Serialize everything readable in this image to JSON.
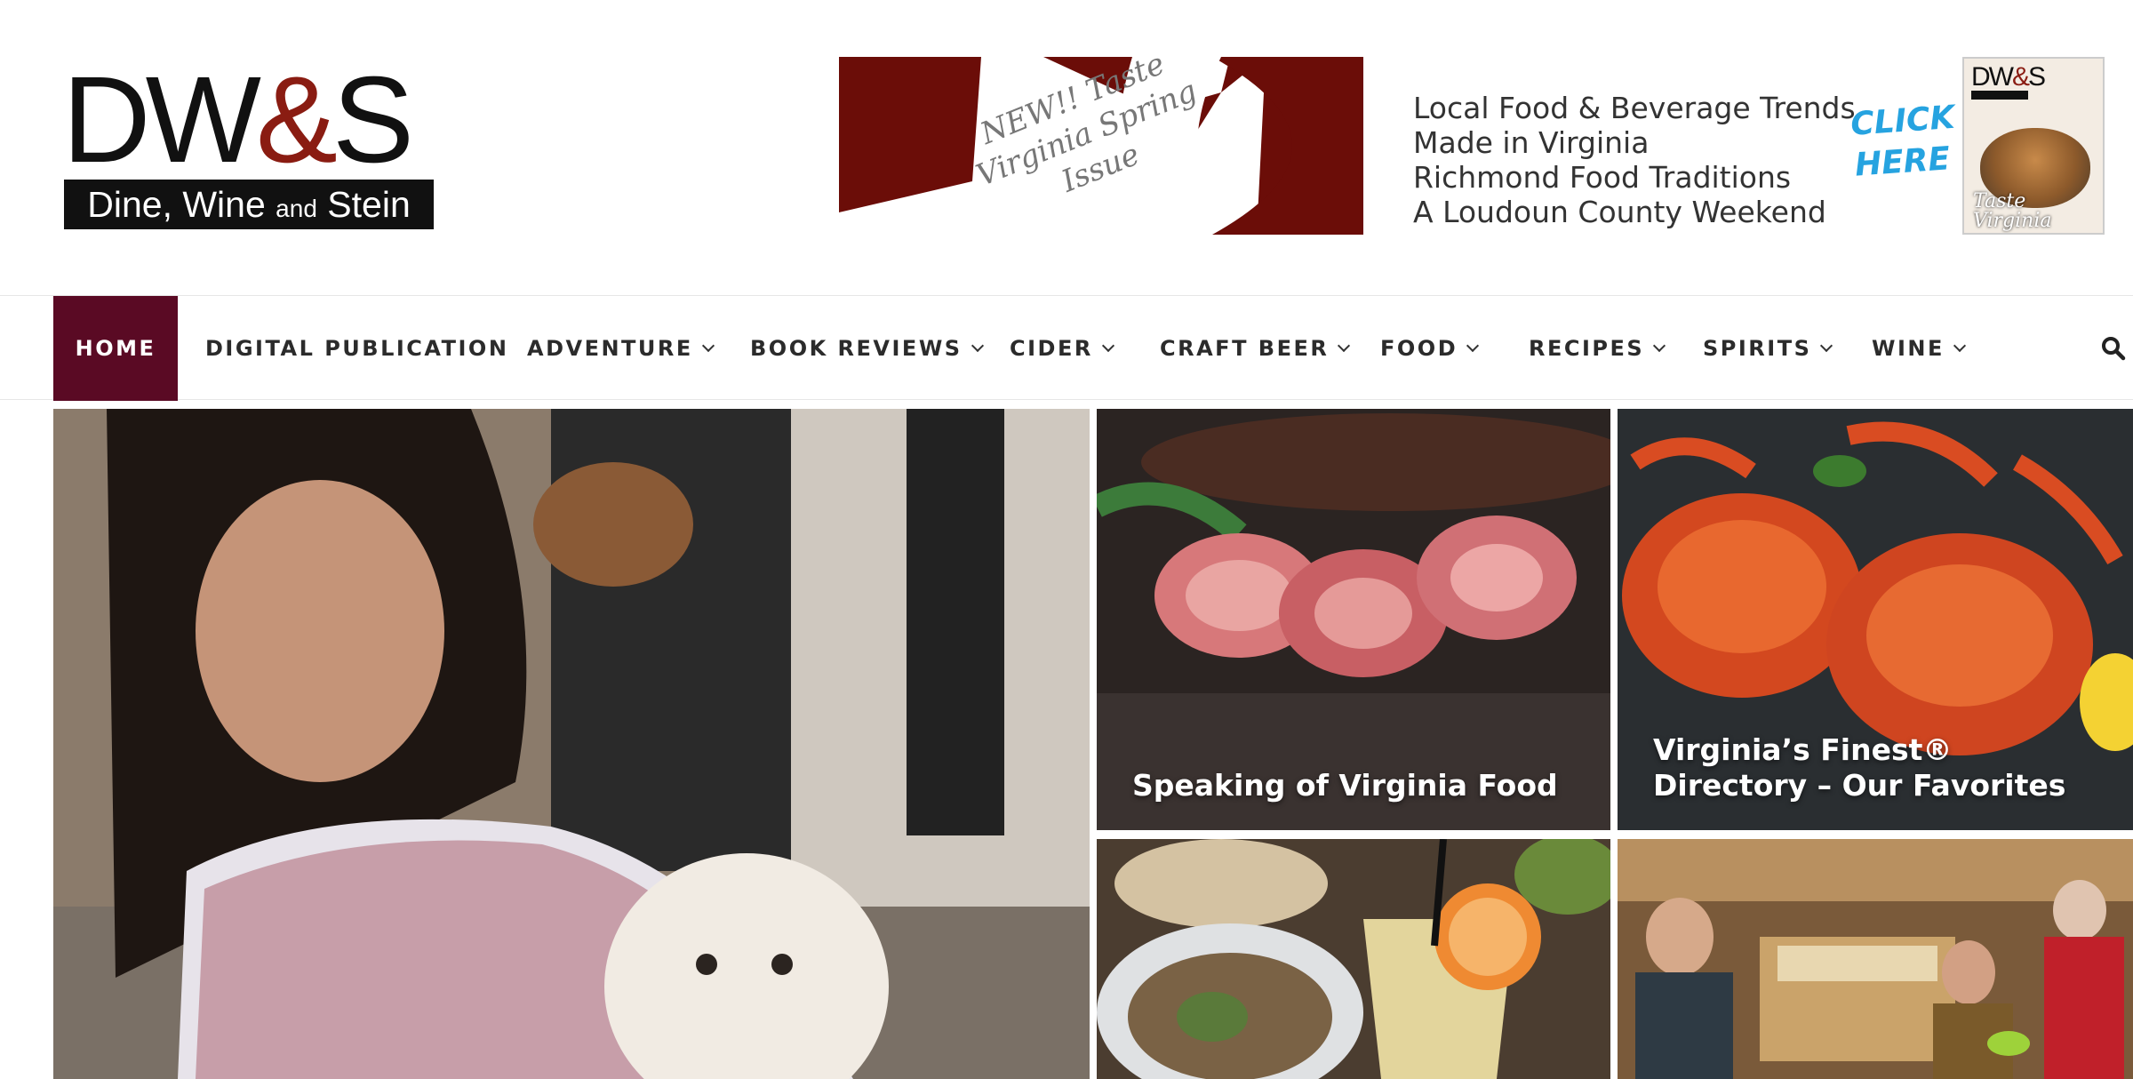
{
  "brand": {
    "logo_top_dw": "DW",
    "logo_top_amp": "&",
    "logo_top_s": "S",
    "logo_name_1": "Dine, Wine",
    "logo_name_and": "and",
    "logo_name_2": "Stein",
    "accent_color": "#8a1c12"
  },
  "banner": {
    "stamp_lines": [
      "NEW!! Taste",
      "Virginia Spring",
      "Issue"
    ],
    "lines": [
      "Local Food & Beverage Trends",
      "Made in Virginia",
      "Richmond Food Traditions",
      "A Loudoun County Weekend"
    ],
    "cta_lines": [
      "CLICK",
      "HERE"
    ],
    "magazine_logo_dw": "DW",
    "magazine_logo_amp": "&",
    "magazine_logo_s": "S",
    "magazine_title_lines": [
      "Taste",
      "Virginia"
    ],
    "art_color": "#6b0d08",
    "cta_color": "#26a3e0"
  },
  "nav": {
    "active_color": "#5a0a24",
    "items": [
      {
        "label": "HOME",
        "dropdown": false
      },
      {
        "label": "DIGITAL PUBLICATION",
        "dropdown": false
      },
      {
        "label": "ADVENTURE",
        "dropdown": true
      },
      {
        "label": "BOOK REVIEWS",
        "dropdown": true
      },
      {
        "label": "CIDER",
        "dropdown": true
      },
      {
        "label": "CRAFT BEER",
        "dropdown": true
      },
      {
        "label": "FOOD",
        "dropdown": true
      },
      {
        "label": "RECIPES",
        "dropdown": true
      },
      {
        "label": "SPIRITS",
        "dropdown": true
      },
      {
        "label": "WINE",
        "dropdown": true
      }
    ],
    "search_icon": "search-icon"
  },
  "featured": {
    "ham_caption": "Speaking of Virginia Food",
    "crab_caption": "Virginia’s Finest® Directory – Our Favorites"
  }
}
